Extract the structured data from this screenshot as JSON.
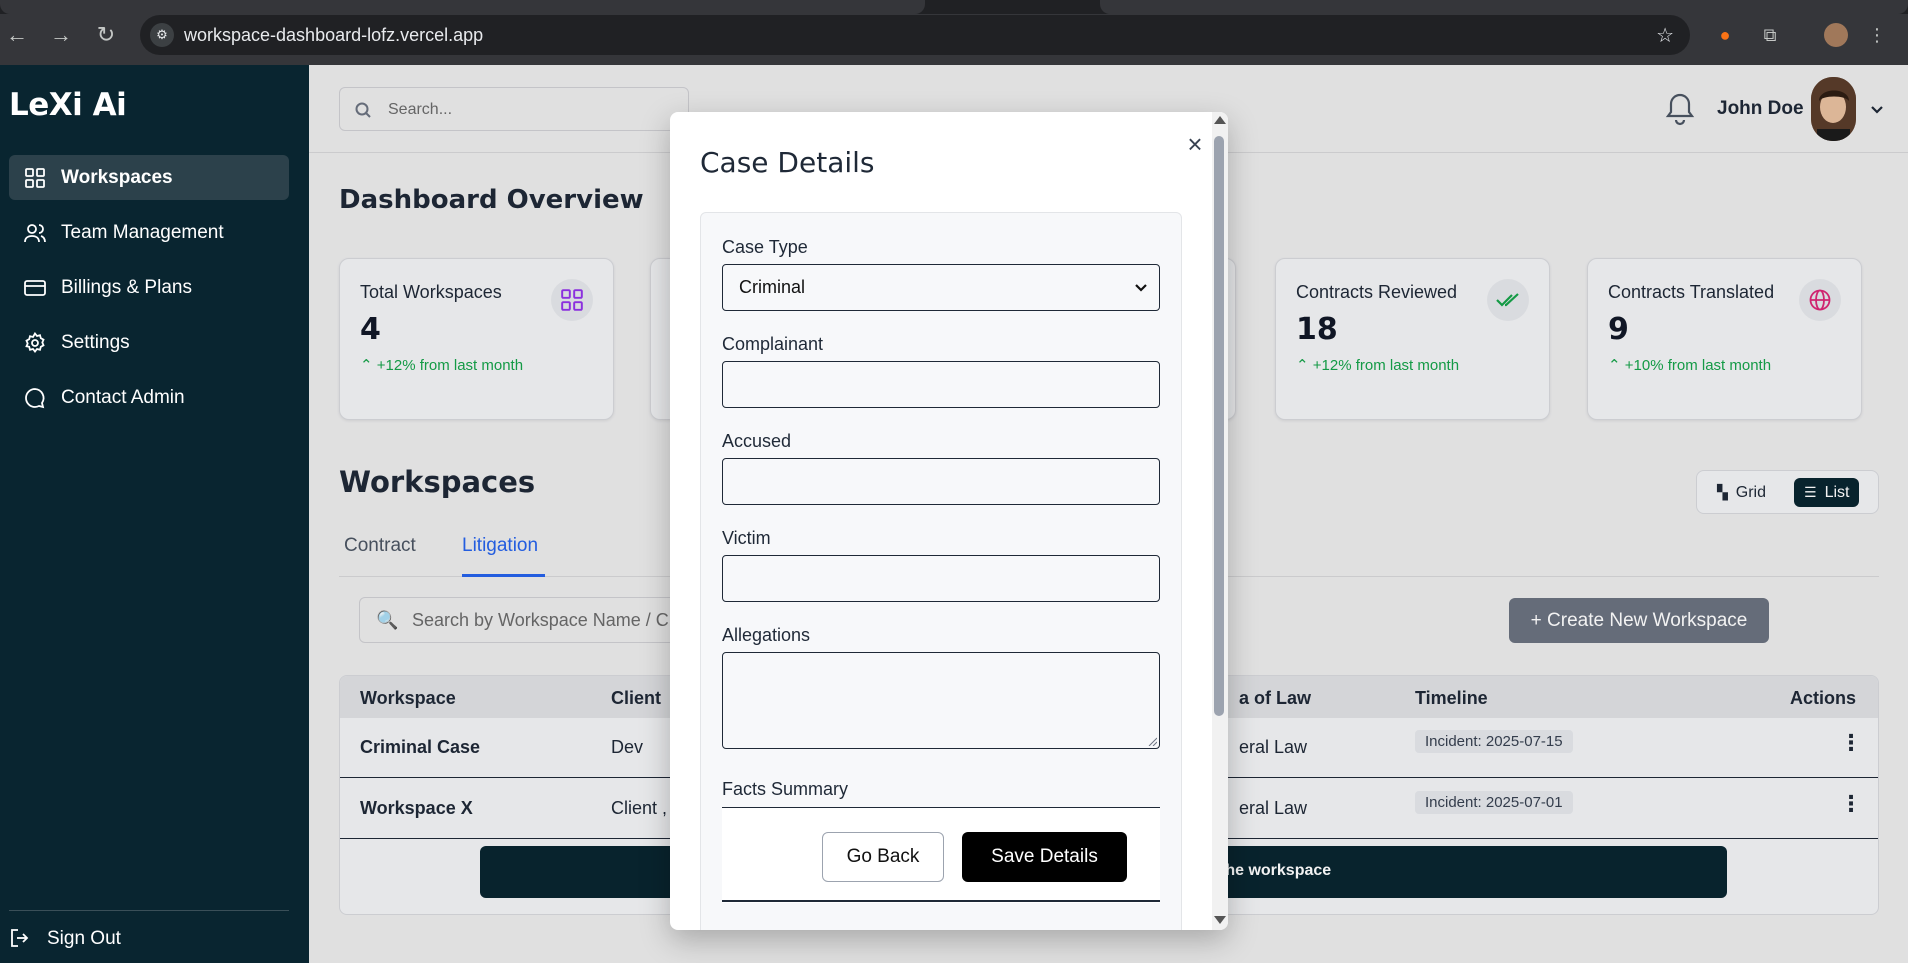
{
  "browser": {
    "url": "workspace-dashboard-lofz.vercel.app"
  },
  "sidebar": {
    "logo": "LeXi Ai",
    "items": [
      {
        "label": "Workspaces",
        "icon": "grid-icon"
      },
      {
        "label": "Team Management",
        "icon": "users-icon"
      },
      {
        "label": "Billings & Plans",
        "icon": "card-icon"
      },
      {
        "label": "Settings",
        "icon": "gear-icon"
      },
      {
        "label": "Contact Admin",
        "icon": "chat-icon"
      }
    ],
    "signout": "Sign Out"
  },
  "header": {
    "search_placeholder": "Search...",
    "user_name": "John Doe"
  },
  "dashboard": {
    "title": "Dashboard Overview",
    "stats": [
      {
        "label": "Total Workspaces",
        "value": "4",
        "trend": "+12% from last month",
        "icon": "grid-icon",
        "icon_color": "#9333ea"
      },
      {
        "label": "Contracts Reviewed",
        "value": "18",
        "trend": "+12% from last month",
        "icon": "double-check-icon",
        "icon_color": "#16a34a"
      },
      {
        "label": "Contracts Translated",
        "value": "9",
        "trend": "+10% from last month",
        "icon": "globe-icon",
        "icon_color": "#db2777"
      }
    ]
  },
  "workspaces": {
    "title": "Workspaces",
    "view_toggle": {
      "grid": "Grid",
      "list": "List"
    },
    "tabs": [
      {
        "label": "Contract"
      },
      {
        "label": "Litigation"
      }
    ],
    "search_placeholder": "Search by Workspace Name / C",
    "create_button": "+ Create New Workspace",
    "columns": [
      "Workspace",
      "Client",
      "a of Law",
      "Timeline",
      "Actions"
    ],
    "rows": [
      {
        "workspace": "Criminal Case",
        "client": "Dev",
        "law": "eral Law",
        "timeline": "Incident: 2025-07-15"
      },
      {
        "workspace": "Workspace X",
        "client": "Client ,",
        "law": "eral Law",
        "timeline": "Incident: 2025-07-01"
      }
    ],
    "info_bar_text": "the workspace"
  },
  "modal": {
    "title": "Case Details",
    "fields": {
      "case_type_label": "Case Type",
      "case_type_value": "Criminal",
      "complainant_label": "Complainant",
      "accused_label": "Accused",
      "victim_label": "Victim",
      "allegations_label": "Allegations",
      "facts_summary_label": "Facts Summary"
    },
    "go_back": "Go Back",
    "save": "Save Details"
  },
  "colors": {
    "sidebar_bg": "#092530",
    "accent_blue": "#2563eb",
    "trend_green": "#16a34a"
  }
}
